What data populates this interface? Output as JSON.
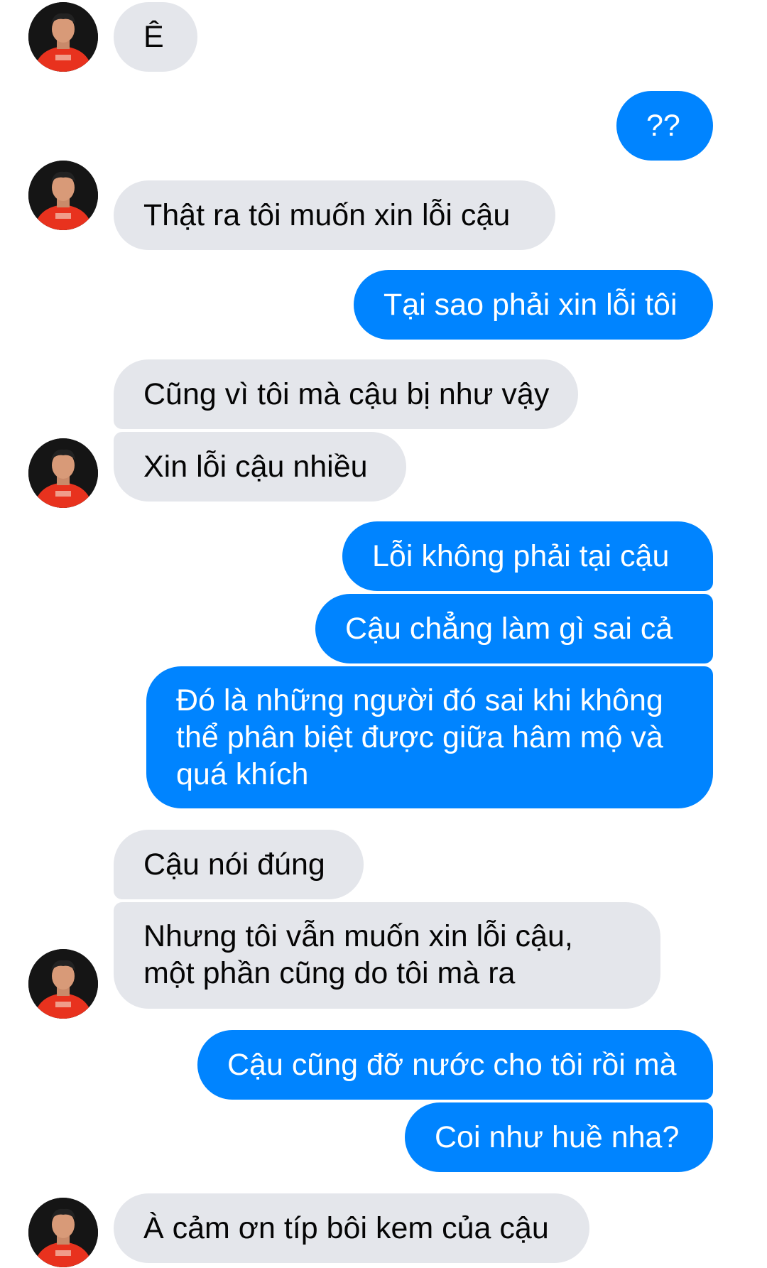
{
  "conversation": {
    "messages": [
      {
        "id": "m1",
        "sender": "contact",
        "text": "Ê"
      },
      {
        "id": "m2",
        "sender": "me",
        "text": "??"
      },
      {
        "id": "m3",
        "sender": "contact",
        "text": "Thật ra tôi muốn xin lỗi cậu"
      },
      {
        "id": "m4",
        "sender": "me",
        "text": "Tại sao phải xin lỗi tôi"
      },
      {
        "id": "m5",
        "sender": "contact",
        "text": "Cũng vì tôi mà cậu bị như vậy"
      },
      {
        "id": "m6",
        "sender": "contact",
        "text": "Xin lỗi cậu nhiều"
      },
      {
        "id": "m7",
        "sender": "me",
        "text": "Lỗi không phải tại cậu"
      },
      {
        "id": "m8",
        "sender": "me",
        "text": "Cậu chẳng làm gì sai cả"
      },
      {
        "id": "m9",
        "sender": "me",
        "text": "Đó là những người đó sai khi không\nthể phân biệt được giữa hâm mộ và\nquá khích"
      },
      {
        "id": "m10",
        "sender": "contact",
        "text": "Cậu nói đúng"
      },
      {
        "id": "m11",
        "sender": "contact",
        "text": "Nhưng tôi vẫn muốn xin lỗi cậu,\nmột phần cũng do tôi mà ra"
      },
      {
        "id": "m12",
        "sender": "me",
        "text": "Cậu cũng đỡ nước cho tôi rồi mà"
      },
      {
        "id": "m13",
        "sender": "me",
        "text": "Coi như huề nha?"
      },
      {
        "id": "m14",
        "sender": "contact",
        "text": "À cảm ơn típ bôi kem của cậu"
      }
    ]
  },
  "colors": {
    "incoming_bubble": "#e4e6eb",
    "outgoing_bubble": "#0084ff",
    "incoming_text": "#050505",
    "outgoing_text": "#ffffff",
    "avatar_shirt": "#e8321e"
  },
  "icons": {
    "avatar": "contact-avatar-photo"
  }
}
